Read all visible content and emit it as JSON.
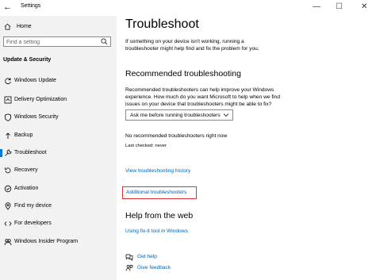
{
  "window": {
    "title": "Settings",
    "back_glyph": "←",
    "minimize_glyph": "—",
    "maximize_glyph": "☐",
    "close_glyph": "✕"
  },
  "sidebar": {
    "home_label": "Home",
    "search_placeholder": "Find a setting",
    "section_heading": "Update & Security",
    "items": [
      {
        "label": "Windows Update",
        "icon": "sync-icon"
      },
      {
        "label": "Delivery Optimization",
        "icon": "delivery-optimization-icon"
      },
      {
        "label": "Windows Security",
        "icon": "shield-icon"
      },
      {
        "label": "Backup",
        "icon": "backup-icon"
      },
      {
        "label": "Troubleshoot",
        "icon": "wrench-icon",
        "active": true
      },
      {
        "label": "Recovery",
        "icon": "recovery-icon"
      },
      {
        "label": "Activation",
        "icon": "activation-check-icon"
      },
      {
        "label": "Find my device",
        "icon": "find-device-icon"
      },
      {
        "label": "For developers",
        "icon": "developer-icon"
      },
      {
        "label": "Windows Insider Program",
        "icon": "insider-icon"
      }
    ]
  },
  "main": {
    "title": "Troubleshoot",
    "intro": "If something on your device isn't working, running a troubleshooter might help find and fix the problem for you.",
    "recommended_heading": "Recommended troubleshooting",
    "recommended_desc": "Recommended troubleshooters can help improve your Windows experience. How much do you want Microsoft to help when we find issues on your device that troubleshooters might be able to fix?",
    "dropdown_value": "Ask me before running troubleshooters",
    "no_recommended": "No recommended troubleshooters right now",
    "last_checked": "Last checked: never",
    "history_link": "View troubleshooting history",
    "additional_link": "Additional troubleshooters",
    "help_heading": "Help from the web",
    "fixit_link": "Using fix-it tool in Windows",
    "get_help": "Get help",
    "give_feedback": "Give feedback"
  },
  "colors": {
    "accent": "#0078d7",
    "link": "#0063b1",
    "highlight_box": "#e03030",
    "sidebar_bg": "#f2f2f2"
  }
}
